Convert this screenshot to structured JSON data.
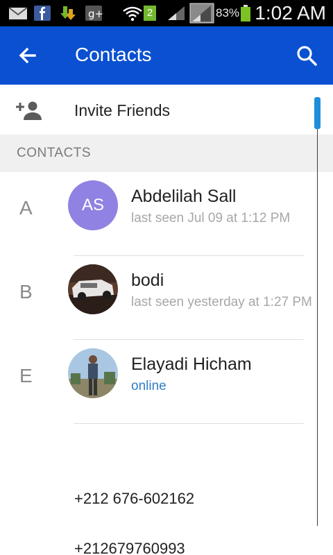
{
  "status_bar": {
    "signal_badge": "2",
    "battery_text": "83%",
    "time": "1:02 AM",
    "icons": [
      "mail-icon",
      "facebook-icon",
      "download-icon",
      "google-plus-icon",
      "wifi-icon",
      "signal-icon",
      "battery-icon"
    ]
  },
  "app_bar": {
    "title": "Contacts",
    "color": "#0a50d0"
  },
  "invite": {
    "label": "Invite Friends"
  },
  "section": {
    "label": "CONTACTS"
  },
  "contacts": [
    {
      "letter": "A",
      "initials": "AS",
      "name": "Abdelilah Sall",
      "status": "last seen Jul 09 at 1:12 PM",
      "online": false
    },
    {
      "letter": "B",
      "initials": "",
      "name": "bodi",
      "status": "last seen yesterday at 1:27 PM",
      "online": false
    },
    {
      "letter": "E",
      "initials": "",
      "name": "Elayadi Hicham",
      "status": "online",
      "online": true
    }
  ],
  "phones": [
    "+212 676-602162",
    "+212679760993"
  ],
  "colors": {
    "accent": "#0a50d0",
    "online": "#2f7dc8",
    "avatar": "#8f82e2",
    "scroll_thumb": "#1f8ed8"
  }
}
